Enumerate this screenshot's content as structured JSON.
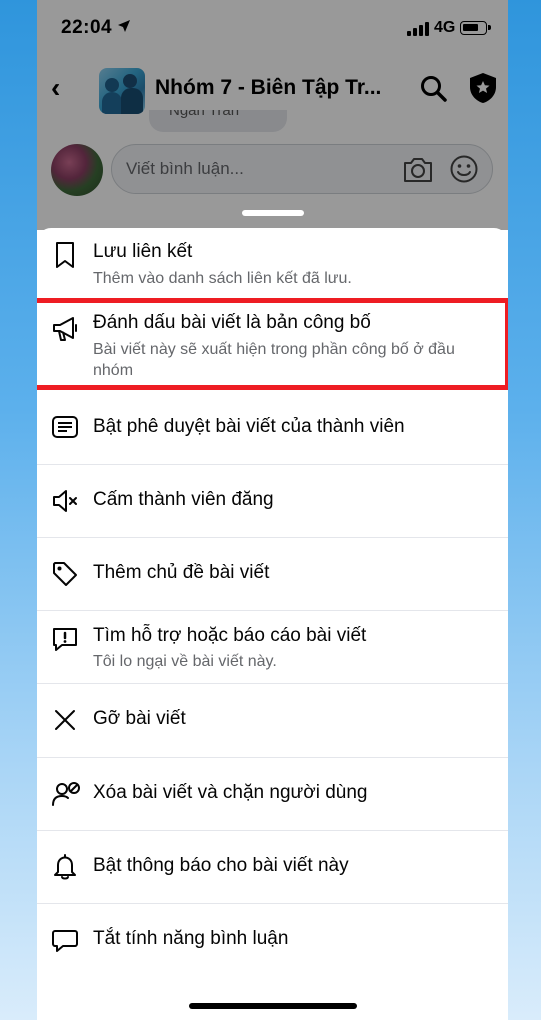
{
  "status_bar": {
    "time": "22:04",
    "network": "4G"
  },
  "header": {
    "group_title": "Nhóm 7 - Biên Tập Tr...",
    "icons": [
      "back-icon",
      "search-icon",
      "admin-shield-icon"
    ]
  },
  "partial_comment_author": "Ngân Trần",
  "comment": {
    "placeholder": "Viết bình luận..."
  },
  "menu": {
    "items": [
      {
        "title": "Lưu liên kết",
        "subtitle": "Thêm vào danh sách liên kết đã lưu.",
        "icon": "bookmark-icon"
      },
      {
        "title": "Đánh dấu bài viết là bản công bố",
        "subtitle": "Bài viết này sẽ xuất hiện trong phần công bố ở đầu nhóm",
        "icon": "megaphone-icon",
        "highlighted": true
      },
      {
        "title": "Bật phê duyệt bài viết của thành viên",
        "icon": "post-approval-icon"
      },
      {
        "title": "Cấm thành viên đăng",
        "icon": "mute-speaker-icon"
      },
      {
        "title": "Thêm chủ đề bài viết",
        "icon": "tag-icon"
      },
      {
        "title": "Tìm hỗ trợ hoặc báo cáo bài viết",
        "subtitle": "Tôi lo ngại về bài viết này.",
        "icon": "report-icon"
      },
      {
        "title": "Gỡ bài viết",
        "icon": "close-icon"
      },
      {
        "title": "Xóa bài viết và chặn người dùng",
        "icon": "block-user-icon"
      },
      {
        "title": "Bật thông báo cho bài viết này",
        "icon": "bell-icon"
      },
      {
        "title": "Tắt tính năng bình luận",
        "icon": "comment-icon"
      }
    ]
  },
  "colors": {
    "highlight_border": "#ee1d23",
    "background_gradient_top": "#2f95dc"
  }
}
